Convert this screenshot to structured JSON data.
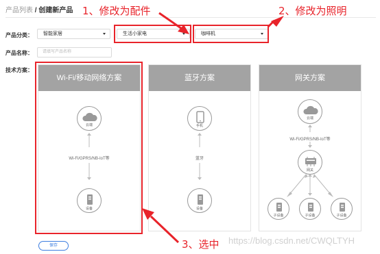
{
  "breadcrumb": {
    "parent": "产品列表",
    "separator": "/",
    "current": "创建新产品"
  },
  "form": {
    "category_label": "产品分类：",
    "category_1": "智能家居",
    "category_2": "生活小家电",
    "category_3": "咖啡机",
    "name_label": "产品名称：",
    "name_placeholder": "请填写产品名称",
    "tech_label": "技术方案："
  },
  "cards": {
    "wifi": {
      "title": "Wi-Fi/移动网络方案",
      "cloud": "云端",
      "link": "Wi-Fi/GPRS/NB-IoT等",
      "device": "设备"
    },
    "bluetooth": {
      "title": "蓝牙方案",
      "phone": "手机",
      "link": "蓝牙",
      "device": "设备"
    },
    "gateway": {
      "title": "网关方案",
      "cloud": "云端",
      "link": "Wi-Fi/GPRS/NB-IoT等",
      "gateway": "网关",
      "sub1": "子设备",
      "sub2": "子设备",
      "sub3": "子设备"
    }
  },
  "save_label": "保存",
  "annotations": {
    "a1": "1、修改为配件",
    "a2": "2、修改为照明",
    "a3": "3、选中"
  },
  "watermark": "https://blog.csdn.net/CWQLTYH",
  "colors": {
    "annotation_red": "#e8232a",
    "card_header_gray": "#a3a3a3",
    "primary_blue": "#3c7de0"
  }
}
